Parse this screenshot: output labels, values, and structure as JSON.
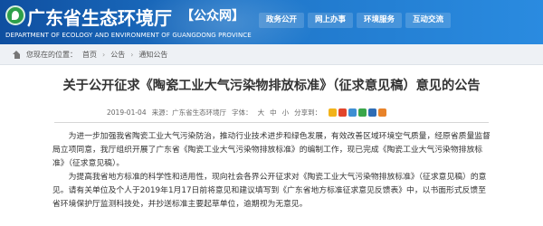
{
  "header": {
    "title": "广东省生态环境厅",
    "tag": "【公众网】",
    "subtitle": "DEPARTMENT OF ECOLOGY AND ENVIRONMENT OF GUANGDONG PROVINCE",
    "nav": [
      "政务公开",
      "网上办事",
      "环境服务",
      "互动交流"
    ]
  },
  "breadcrumb": {
    "label": "您现在的位置：",
    "items": [
      "首页",
      "公告",
      "通知公告"
    ]
  },
  "article": {
    "title": "关于公开征求《陶瓷工业大气污染物排放标准》（征求意见稿）意见的公告",
    "date": "2019-01-04",
    "source": "来源：广东省生态环境厅",
    "font_label": "字体：",
    "font_sizes": [
      "大",
      "中",
      "小"
    ],
    "share_label": "分享到：",
    "share_icons": [
      {
        "name": "qzone-share-icon",
        "color": "#f2b31a"
      },
      {
        "name": "weibo-share-icon",
        "color": "#e2452b"
      },
      {
        "name": "tencent-weibo-share-icon",
        "color": "#3e8fd3"
      },
      {
        "name": "wechat-share-icon",
        "color": "#3aa64a"
      },
      {
        "name": "renren-share-icon",
        "color": "#2f6db5"
      },
      {
        "name": "more-share-icon",
        "color": "#e8832a"
      }
    ],
    "paragraphs": [
      "为进一步加强我省陶瓷工业大气污染防治，推动行业技术进步和绿色发展，有效改善区域环境空气质量，经原省质量监督局立项同意，我厅组织开展了广东省《陶瓷工业大气污染物排放标准》的编制工作，现已完成《陶瓷工业大气污染物排放标准》（征求意见稿）。",
      "为提高我省地方标准的科学性和适用性，现向社会各界公开征求对《陶瓷工业大气污染物排放标准》（征求意见稿）的意见。请有关单位及个人于2019年1月17日前将意见和建议填写到《广东省地方标准征求意见反馈表》中，以书面形式反馈至省环境保护厅监测科技处，并抄送标准主要起草单位，逾期视为无意见。"
    ]
  }
}
